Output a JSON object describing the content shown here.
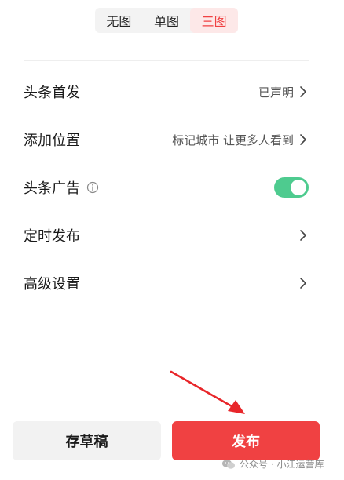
{
  "tabs": {
    "items": [
      "无图",
      "单图",
      "三图"
    ],
    "active_index": 2
  },
  "settings": {
    "first_publish": {
      "label": "头条首发",
      "value": "已声明"
    },
    "location": {
      "label": "添加位置",
      "value": "标记城市 让更多人看到"
    },
    "ads": {
      "label": "头条广告",
      "enabled": true
    },
    "schedule": {
      "label": "定时发布"
    },
    "advanced": {
      "label": "高级设置"
    }
  },
  "actions": {
    "draft_label": "存草稿",
    "publish_label": "发布"
  },
  "watermark": {
    "text": "公众号 · 小江运营库"
  },
  "colors": {
    "accent": "#f04142",
    "toggle_on": "#4ecb8f",
    "annotation_arrow": "#e8262a"
  },
  "icons": {
    "info": "info-icon",
    "chevron": "chevron-right-icon",
    "watermark": "wechat-icon"
  }
}
